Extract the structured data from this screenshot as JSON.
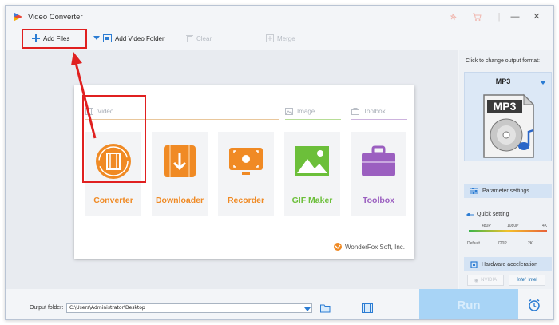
{
  "app": {
    "title": "Video Converter",
    "window_controls": [
      "pin-icon",
      "cart-icon",
      "minimize-icon",
      "close-icon"
    ]
  },
  "toolbar": {
    "add_files": "Add Files",
    "add_video_folder": "Add Video Folder",
    "clear": "Clear",
    "merge": "Merge"
  },
  "home": {
    "sections": {
      "video": "Video",
      "image": "Image",
      "toolbox": "Toolbox"
    },
    "tiles": [
      {
        "label": "Converter",
        "color": "#f08a24",
        "icon": "film-icon"
      },
      {
        "label": "Downloader",
        "color": "#f08a24",
        "icon": "download-icon"
      },
      {
        "label": "Recorder",
        "color": "#f08a24",
        "icon": "monitor-record-icon"
      },
      {
        "label": "GIF Maker",
        "color": "#6cbf3a",
        "icon": "image-mountain-icon"
      },
      {
        "label": "Toolbox",
        "color": "#9b5fc0",
        "icon": "toolbox-icon"
      }
    ],
    "brand": "WonderFox Soft, Inc."
  },
  "side": {
    "hint": "Click to change output format:",
    "format": "MP3",
    "parameter_settings": "Parameter settings",
    "quick_setting": "Quick setting",
    "ticks_top": [
      "480P",
      "1080P",
      "4K"
    ],
    "ticks_bottom": [
      "Default",
      "720P",
      "2K"
    ],
    "hardware_acceleration": "Hardware acceleration",
    "nvidia": "NVIDIA",
    "intel": "Intel"
  },
  "bottom": {
    "output_folder_label": "Output folder:",
    "output_path": "C:\\Users\\Administrator\\Desktop",
    "run": "Run"
  },
  "colors": {
    "accent_blue": "#2b7cd3",
    "annotation_red": "#e02020",
    "orange": "#f08a24",
    "green": "#6cbf3a",
    "purple": "#9b5fc0"
  }
}
